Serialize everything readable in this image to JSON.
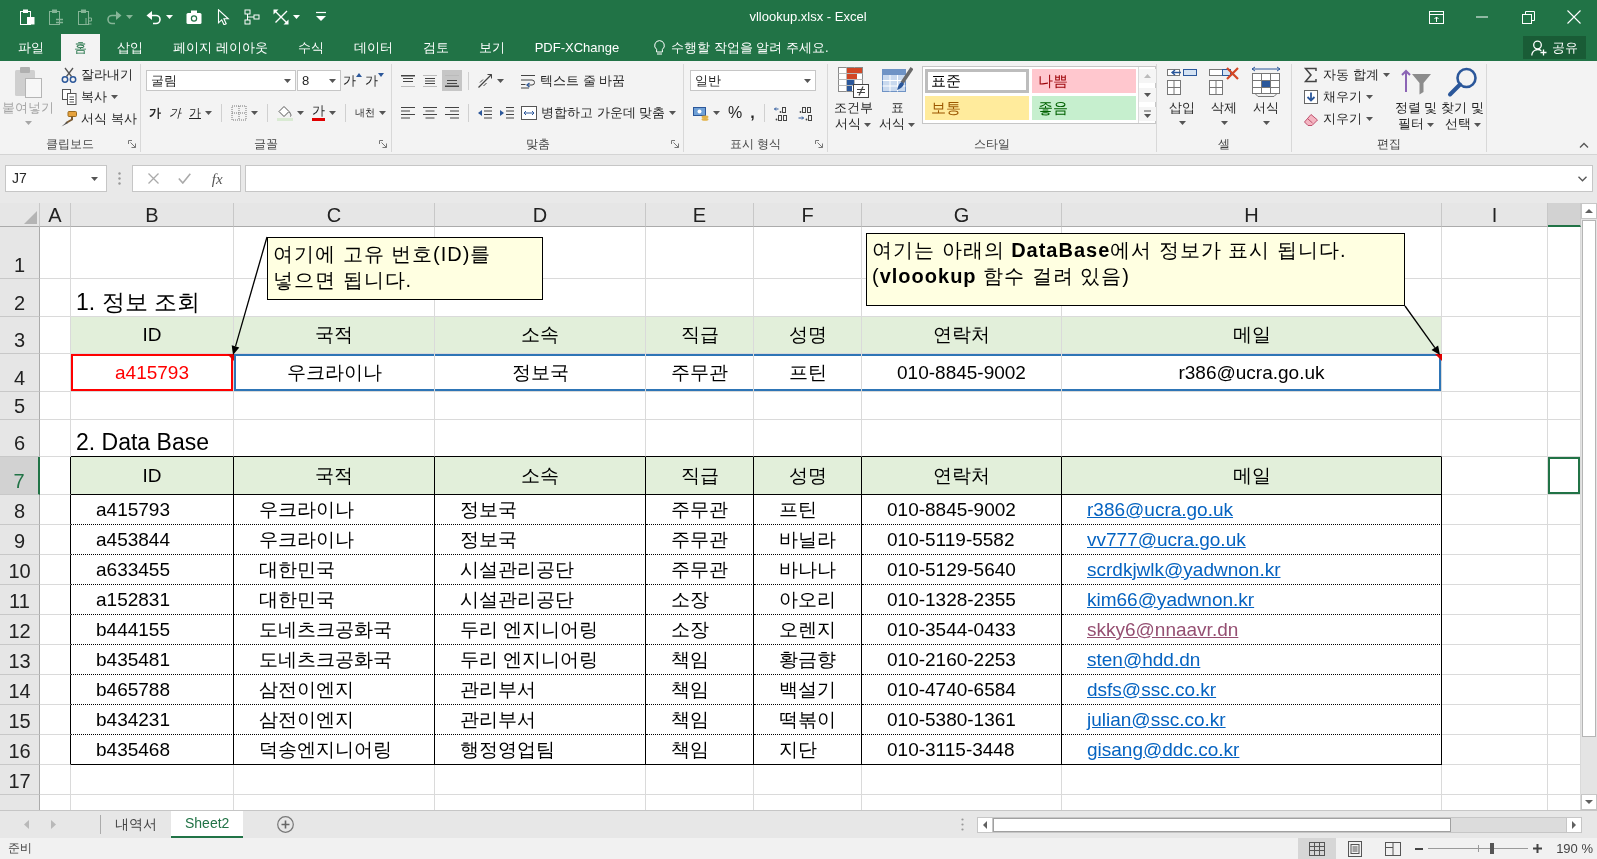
{
  "window": {
    "title": "vllookup.xlsx - Excel"
  },
  "quick_access": [
    {
      "kind": "clipboard",
      "disabled": false
    },
    {
      "kind": "paste-link",
      "disabled": true
    },
    {
      "kind": "paste-number",
      "disabled": true
    },
    {
      "kind": "redo",
      "disabled": true
    },
    {
      "kind": "undo",
      "disabled": false
    },
    {
      "kind": "camera",
      "disabled": false
    },
    {
      "kind": "pointer",
      "disabled": false
    },
    {
      "kind": "select",
      "disabled": false
    },
    {
      "kind": "shapes",
      "disabled": false
    },
    {
      "kind": "customize",
      "disabled": false
    }
  ],
  "ribbon_tabs": [
    {
      "label": "파일",
      "selected": false
    },
    {
      "label": "홈",
      "selected": true
    },
    {
      "label": "삽입",
      "selected": false
    },
    {
      "label": "페이지 레이아웃",
      "selected": false
    },
    {
      "label": "수식",
      "selected": false
    },
    {
      "label": "데이터",
      "selected": false
    },
    {
      "label": "검토",
      "selected": false
    },
    {
      "label": "보기",
      "selected": false
    },
    {
      "label": "PDF-XChange",
      "selected": false
    }
  ],
  "tell_me": "수행할 작업을 알려 주세요.",
  "share_button": "공유",
  "ribbon": {
    "clipboard": {
      "label": "클립보드",
      "paste": {
        "label": "붙여넣기",
        "disabled": true
      },
      "cut": "잘라내기",
      "copy": "복사",
      "format_painter": "서식 복사"
    },
    "font": {
      "label": "글꼴",
      "font_name": "굴림",
      "font_size": "8",
      "grow": "가",
      "shrink": "가",
      "bold": "가",
      "italic": "가",
      "underline": "가",
      "font_color": "가",
      "phonetic": "내천"
    },
    "alignment": {
      "label": "맞춤",
      "vertical": [
        {
          "selected": false
        },
        {
          "selected": false
        },
        {
          "selected": true
        }
      ],
      "wrap_text": "텍스트 줄 바꿈",
      "merge_center": "병합하고 가운데 맞춤"
    },
    "number": {
      "label": "표시 형식",
      "format": "일반",
      "percent": "%",
      "comma": ","
    },
    "styles": {
      "label": "스타일",
      "conditional_formatting": "조건부 서식",
      "format_as_table": "표 서식",
      "gallery": [
        {
          "label": "표준",
          "kind": "normal",
          "selected": true,
          "color": "#ffffff"
        },
        {
          "label": "나쁨",
          "kind": "bad",
          "selected": false,
          "color": "#ffc7ce"
        },
        {
          "label": "보통",
          "kind": "neutral",
          "selected": false,
          "color": "#ffeb9c"
        },
        {
          "label": "좋음",
          "kind": "good",
          "selected": false,
          "color": "#c6efce"
        }
      ]
    },
    "cells": {
      "label": "셀",
      "insert": "삽입",
      "delete": "삭제",
      "format": "서식"
    },
    "editing": {
      "label": "편집",
      "autosum": "자동 합계",
      "fill": "채우기",
      "clear": "지우기",
      "sort_filter": "정렬 및 필터",
      "find_select": "찾기 및 선택"
    }
  },
  "formula_bar": {
    "name_box": "J7",
    "insert_function": "fx"
  },
  "column_headers": [
    {
      "label": "A",
      "selected": false
    },
    {
      "label": "B",
      "selected": false
    },
    {
      "label": "C",
      "selected": false
    },
    {
      "label": "D",
      "selected": false
    },
    {
      "label": "E",
      "selected": false
    },
    {
      "label": "F",
      "selected": false
    },
    {
      "label": "G",
      "selected": false
    },
    {
      "label": "H",
      "selected": false
    },
    {
      "label": "I",
      "selected": false
    },
    {
      "selected": true
    }
  ],
  "row_headers": [
    {
      "label": "1",
      "selected": false
    },
    {
      "label": "2",
      "selected": false
    },
    {
      "label": "3",
      "selected": false
    },
    {
      "label": "4",
      "selected": false
    },
    {
      "label": "5",
      "selected": false
    },
    {
      "label": "6",
      "selected": false
    },
    {
      "label": "7",
      "selected": true
    },
    {
      "label": "8",
      "selected": false
    },
    {
      "label": "9",
      "selected": false
    },
    {
      "label": "10",
      "selected": false
    },
    {
      "label": "11",
      "selected": false
    },
    {
      "label": "12",
      "selected": false
    },
    {
      "label": "13",
      "selected": false
    },
    {
      "label": "14",
      "selected": false
    },
    {
      "label": "15",
      "selected": false
    },
    {
      "label": "16",
      "selected": false
    },
    {
      "label": "17",
      "selected": false
    }
  ],
  "sheet": {
    "lookup_title": "1. 정보 조회",
    "lookup_header": [
      "ID",
      "국적",
      "소속",
      "직급",
      "성명",
      "연락처",
      "메일"
    ],
    "lookup_row": [
      "a415793",
      "우크라이나",
      "정보국",
      "주무관",
      "프틴",
      "010-8845-9002",
      "r386@ucra.go.uk"
    ],
    "database_title": "2. Data Base",
    "database_header": [
      "ID",
      "국적",
      "소속",
      "직급",
      "성명",
      "연락처",
      "메일"
    ],
    "database_rows": [
      {
        "cells": [
          "a415793",
          "우크라이나",
          "정보국",
          "주무관",
          "프틴",
          "010-8845-9002"
        ],
        "email": "r386@ucra.go.uk",
        "visited": false
      },
      {
        "cells": [
          "a453844",
          "우크라이나",
          "정보국",
          "주무관",
          "바닐라",
          "010-5119-5582"
        ],
        "email": "vv777@ucra.go.uk",
        "visited": false
      },
      {
        "cells": [
          "a633455",
          "대한민국",
          "시설관리공단",
          "주무관",
          "바나나",
          "010-5129-5640"
        ],
        "email": "scrdkjwlk@yadwnon.kr",
        "visited": false
      },
      {
        "cells": [
          "a152831",
          "대한민국",
          "시설관리공단",
          "소장",
          "아오리",
          "010-1328-2355"
        ],
        "email": "kim66@yadwnon.kr",
        "visited": false
      },
      {
        "cells": [
          "b444155",
          "도네츠크공화국",
          "두리 엔지니어링",
          "소장",
          "오렌지",
          "010-3544-0433"
        ],
        "email": "skky6@nnaavr.dn",
        "visited": true
      },
      {
        "cells": [
          "b435481",
          "도네츠크공화국",
          "두리 엔지니어링",
          "책임",
          "황금향",
          "010-2160-2253"
        ],
        "email": "sten@hdd.dn",
        "visited": false
      },
      {
        "cells": [
          "b465788",
          "삼전이엔지",
          "관리부서",
          "책임",
          "백설기",
          "010-4740-6584"
        ],
        "email": "dsfs@ssc.co.kr",
        "visited": false
      },
      {
        "cells": [
          "b434231",
          "삼전이엔지",
          "관리부서",
          "책임",
          "떡볶이",
          "010-5380-1361"
        ],
        "email": "julian@ssc.co.kr",
        "visited": false
      },
      {
        "cells": [
          "b435468",
          "덕송엔지니어링",
          "행정영업팀",
          "책임",
          "지단",
          "010-3115-3448"
        ],
        "email": "gisang@ddc.co.kr",
        "visited": false
      }
    ]
  },
  "comments": [
    {
      "text": "여기에 고유 번호(ID)를 넣으면 됩니다."
    },
    {
      "text": "여기는 아래의 **DataBase**에서 정보가 표시 됩니다. (**vloookup** 함수 걸려 있음)"
    }
  ],
  "sheet_tabs": [
    {
      "label": "내역서",
      "selected": false
    },
    {
      "label": "Sheet2",
      "selected": true
    }
  ],
  "status_bar": {
    "status": "준비",
    "views": [
      {
        "kind": "normal",
        "selected": true
      },
      {
        "kind": "page-layout",
        "selected": false
      },
      {
        "kind": "page-break",
        "selected": false
      }
    ],
    "zoom": {
      "level": 0.64,
      "reading": "190 %"
    }
  }
}
